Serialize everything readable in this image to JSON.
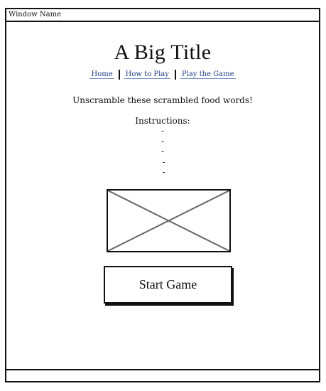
{
  "window": {
    "title": "Window Name"
  },
  "page": {
    "title": "A Big Title",
    "nav": [
      {
        "label": "Home"
      },
      {
        "label": "How to Play"
      },
      {
        "label": "Play the Game"
      }
    ],
    "subtitle": "Unscramble these scrambled food words!",
    "instructions_heading": "Instructions:",
    "instructions": [
      "-",
      "-",
      "-",
      "-",
      "-"
    ],
    "start_button_label": "Start Game"
  }
}
